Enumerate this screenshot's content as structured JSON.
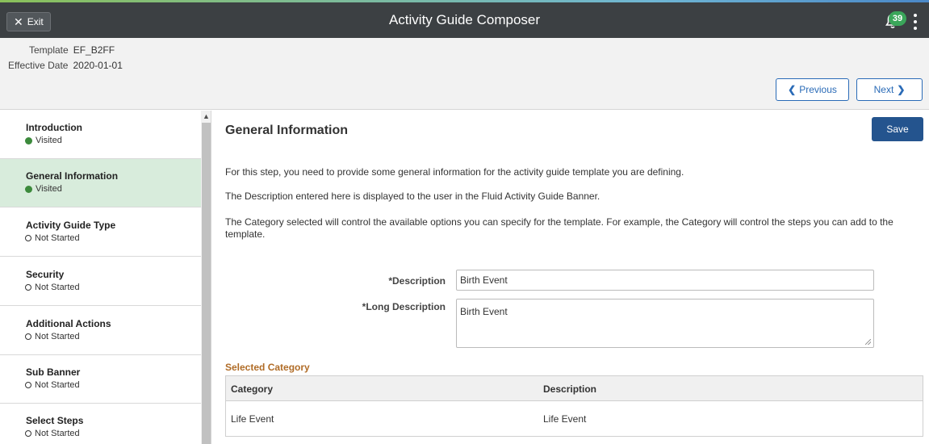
{
  "topbar": {
    "exit_label": "Exit",
    "title": "Activity Guide Composer",
    "notification_count": "39"
  },
  "header": {
    "template_label": "Template",
    "template_value": "EF_B2FF",
    "effective_date_label": "Effective Date",
    "effective_date_value": "2020-01-01",
    "previous_label": "Previous",
    "next_label": "Next"
  },
  "sidebar": {
    "items": [
      {
        "label": "Introduction",
        "status": "Visited"
      },
      {
        "label": "General Information",
        "status": "Visited"
      },
      {
        "label": "Activity Guide Type",
        "status": "Not Started"
      },
      {
        "label": "Security",
        "status": "Not Started"
      },
      {
        "label": "Additional Actions",
        "status": "Not Started"
      },
      {
        "label": "Sub Banner",
        "status": "Not Started"
      },
      {
        "label": "Select Steps",
        "status": "Not Started"
      }
    ],
    "active_index": 1
  },
  "main": {
    "title": "General Information",
    "save_label": "Save",
    "paragraphs": [
      "For this step, you need to provide some general information for the activity guide template you are defining.",
      "The Description entered here is displayed to the user in the Fluid Activity Guide Banner.",
      "The Category selected will control the available options you can specify for the template. For example, the Category will control the steps you can add to the template."
    ],
    "description_label": "*Description",
    "description_value": "Birth Event",
    "long_description_label": "*Long Description",
    "long_description_value": "Birth Event",
    "selected_category_title": "Selected Category",
    "grid": {
      "headers": [
        "Category",
        "Description"
      ],
      "rows": [
        [
          "Life Event",
          "Life Event"
        ]
      ]
    }
  },
  "colors": {
    "active_step": "#d8ecdc",
    "primary_button": "#24548e",
    "visited_dot": "#3c8a3c",
    "section_title": "#b06c27"
  }
}
